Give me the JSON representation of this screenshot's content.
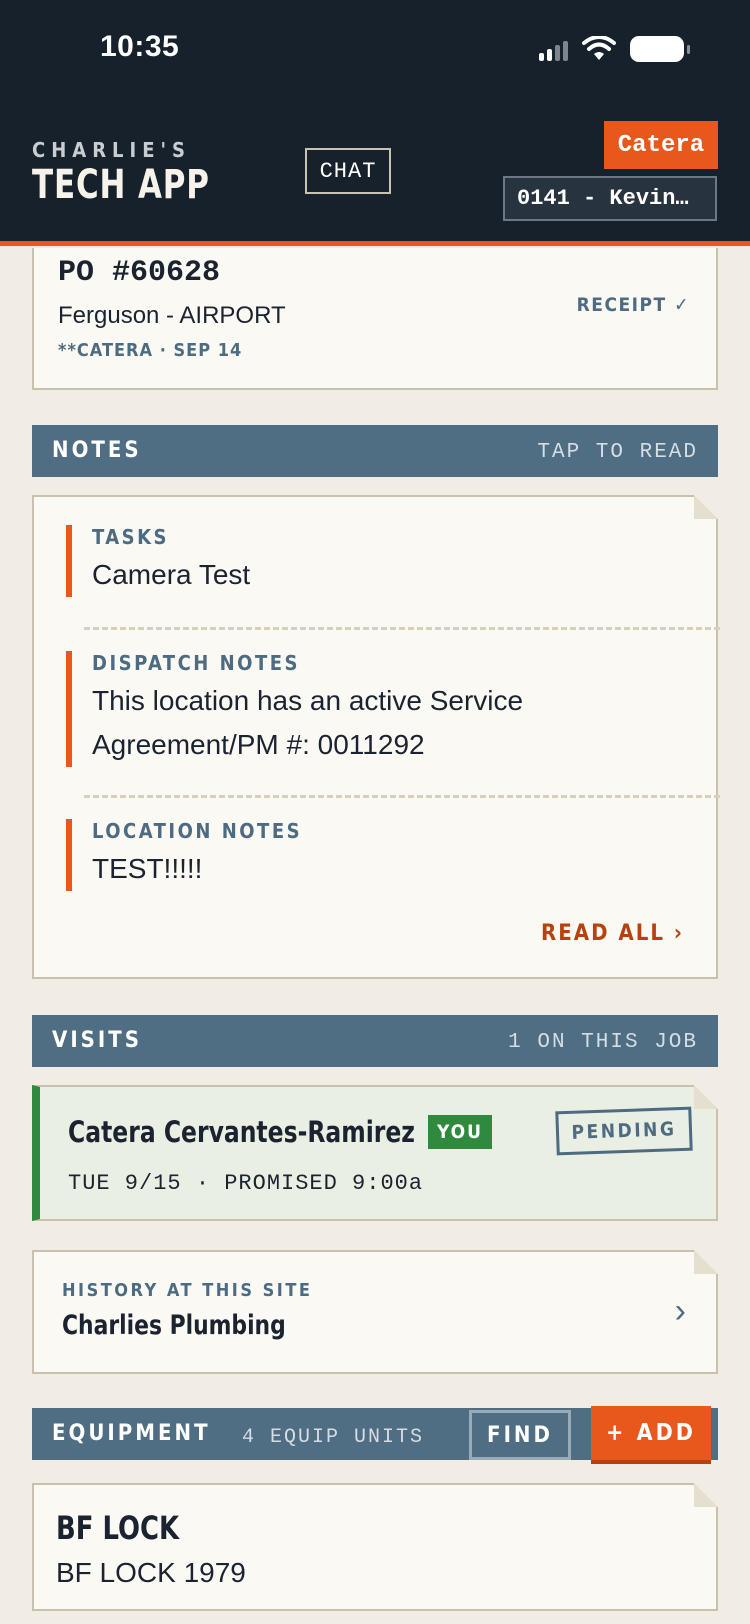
{
  "status_bar": {
    "time": "10:35"
  },
  "header": {
    "brand_top": "CHARLIE'S",
    "brand_main": "TECH APP",
    "chat_label": "CHAT",
    "user_badge": "Catera",
    "job_selector": "0141 - Kevin…"
  },
  "po": {
    "number": "PO #60628",
    "vendor": "Ferguson - AIRPORT",
    "meta": "**CATERA · SEP 14",
    "receipt": "RECEIPT ✓"
  },
  "notes": {
    "title": "NOTES",
    "action": "TAP TO READ",
    "items": [
      {
        "label": "TASKS",
        "text": "Camera Test"
      },
      {
        "label": "DISPATCH NOTES",
        "text": "This location has an active Service Agreement/PM #: 0011292"
      },
      {
        "label": "LOCATION NOTES",
        "text": "TEST!!!!!"
      }
    ],
    "read_all": "READ ALL ›"
  },
  "visits": {
    "title": "VISITS",
    "count": "1 ON THIS JOB",
    "items": [
      {
        "tech": "Catera Cervantes-Ramirez",
        "you_badge": "YOU",
        "when": "TUE 9/15 · PROMISED 9:00a",
        "status": "PENDING"
      }
    ]
  },
  "history": {
    "label": "HISTORY AT THIS SITE",
    "name": "Charlies Plumbing",
    "chevron": "›"
  },
  "equipment": {
    "title": "EQUIPMENT",
    "count": "4 EQUIP UNITS",
    "find_label": "FIND",
    "add_label": "+ ADD",
    "items": [
      {
        "name": "BF LOCK",
        "sub": "BF LOCK 1979"
      }
    ]
  },
  "colors": {
    "header_bg": "#17212c",
    "accent": "#e8581c",
    "section_bar": "#4f6d83",
    "visit_green": "#2f8a3e",
    "page_bg": "#f1ede4"
  }
}
